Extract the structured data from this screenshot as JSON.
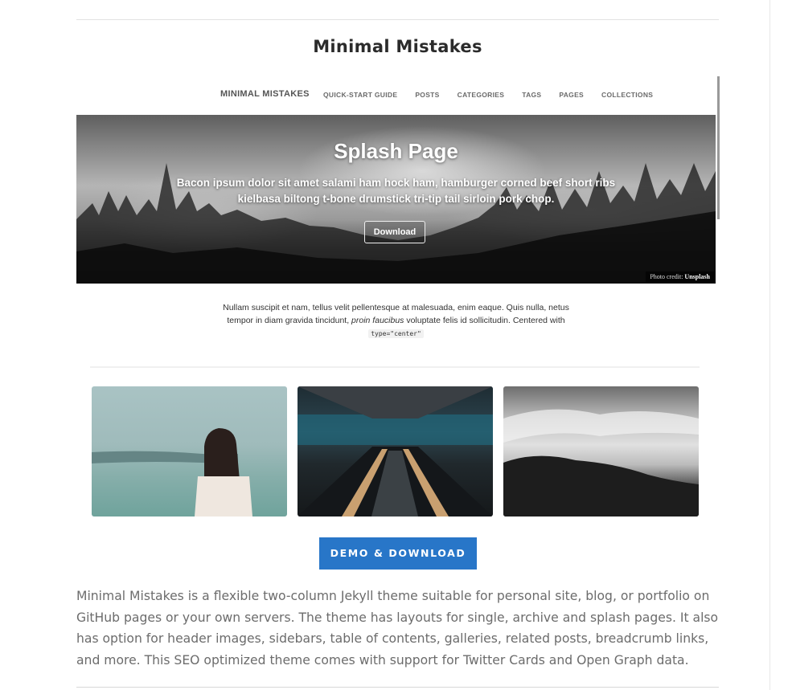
{
  "card": {
    "title": "Minimal Mistakes",
    "cta_label": "DEMO & DOWNLOAD",
    "description": "Minimal Mistakes is a flexible two-column Jekyll theme suitable for personal site, blog, or portfolio on GitHub pages or your own servers. The theme has layouts for single, archive and splash pages. It also has option for header images, sidebars, table of contents, galleries, related posts, breadcrumb links, and more. This SEO optimized theme comes with support for Twitter Cards and Open Graph data."
  },
  "preview": {
    "nav": {
      "brand": "MINIMAL MISTAKES",
      "links": [
        "QUICK-START GUIDE",
        "POSTS",
        "CATEGORIES",
        "TAGS",
        "PAGES",
        "COLLECTIONS"
      ]
    },
    "hero": {
      "title": "Splash Page",
      "subtitle": "Bacon ipsum dolor sit amet salami ham hock ham, hamburger corned beef short ribs kielbasa biltong t-bone drumstick tri-tip tail sirloin pork chop.",
      "button": "Download",
      "credit_prefix": "Photo credit: ",
      "credit_source": "Unsplash"
    },
    "intro": {
      "text_before": "Nullam suscipit et nam, tellus velit pellentesque at malesuada, enim eaque. Quis nulla, netus tempor in diam gravida tincidunt, ",
      "emphasis": "proin faucibus",
      "text_after": " voluptate felis id sollicitudin. Centered with ",
      "code": "type=\"center\""
    }
  },
  "colors": {
    "accent": "#2876c8",
    "body_text": "#6c6c6c",
    "title_text": "#2b2b2b"
  }
}
